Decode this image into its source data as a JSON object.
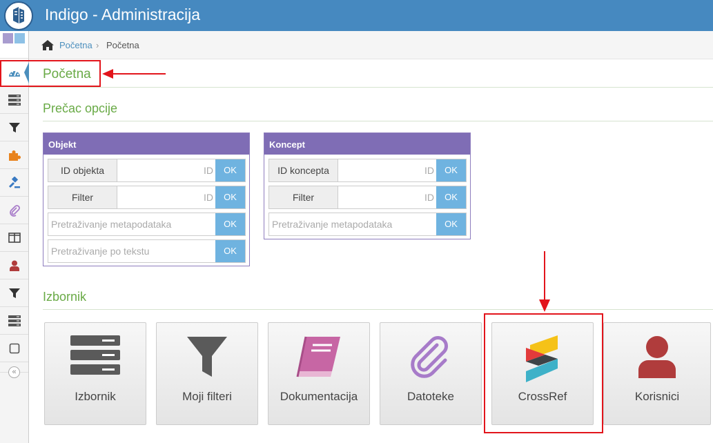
{
  "app": {
    "title": "Indigo - Administracija"
  },
  "breadcrumb": {
    "home_label": "Početna",
    "separator": "›",
    "current": "Početna"
  },
  "page_title": "Početna",
  "shortcuts": {
    "title": "Prečac opcije",
    "object_widget": {
      "title": "Objekt",
      "rows": [
        {
          "label": "ID objekta",
          "placeholder": "ID",
          "button": "OK"
        },
        {
          "label": "Filter",
          "placeholder": "ID",
          "button": "OK"
        },
        {
          "placeholder": "Pretraživanje metapodataka",
          "button": "OK"
        },
        {
          "placeholder": "Pretraživanje po tekstu",
          "button": "OK"
        }
      ]
    },
    "concept_widget": {
      "title": "Koncept",
      "rows": [
        {
          "label": "ID koncepta",
          "placeholder": "ID",
          "button": "OK"
        },
        {
          "label": "Filter",
          "placeholder": "ID",
          "button": "OK"
        },
        {
          "placeholder": "Pretraživanje metapodataka",
          "button": "OK"
        }
      ]
    }
  },
  "menu": {
    "title": "Izbornik",
    "tiles": [
      {
        "label": "Izbornik",
        "icon": "server-icon"
      },
      {
        "label": "Moji filteri",
        "icon": "filter-icon"
      },
      {
        "label": "Dokumentacija",
        "icon": "book-icon"
      },
      {
        "label": "Datoteke",
        "icon": "paperclip-icon"
      },
      {
        "label": "CrossRef",
        "icon": "crossref-logo"
      },
      {
        "label": "Korisnici",
        "icon": "user-icon"
      }
    ]
  },
  "sidebar": {
    "items": [
      {
        "icon": "dashboard-icon",
        "color": "#4c8fbd"
      },
      {
        "icon": "server-icon",
        "color": "#555555"
      },
      {
        "icon": "filter-icon",
        "color": "#333333"
      },
      {
        "icon": "puzzle-icon",
        "color": "#e8831e"
      },
      {
        "icon": "gavel-icon",
        "color": "#3a7ac2"
      },
      {
        "icon": "paperclip-icon",
        "color": "#a77bc9"
      },
      {
        "icon": "columns-icon",
        "color": "#444444"
      },
      {
        "icon": "user-icon",
        "color": "#b03c3c"
      },
      {
        "icon": "filter-icon",
        "color": "#333333"
      },
      {
        "icon": "server-icon",
        "color": "#555555"
      },
      {
        "icon": "square-icon",
        "color": "#555555"
      }
    ],
    "collapse_label": "«"
  },
  "colors": {
    "topbar": "#4689c0",
    "accent_green": "#69aa46",
    "widget_header": "#7f6db5",
    "ok_button": "#6fb3e0",
    "annotation": "#e2141b"
  }
}
